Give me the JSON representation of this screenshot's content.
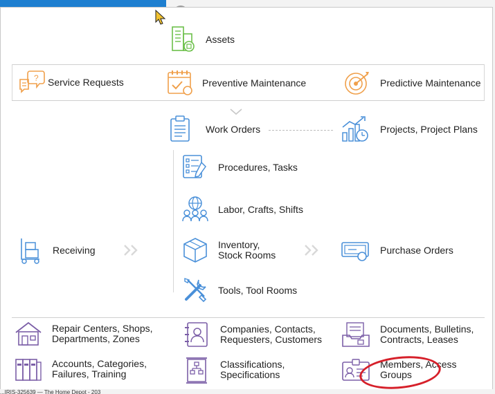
{
  "assets": {
    "label": "Assets"
  },
  "row1": {
    "service": "Service Requests",
    "preventive": "Preventive Maintenance",
    "predictive": "Predictive Maintenance"
  },
  "work": {
    "orders": "Work Orders",
    "projects": "Projects, Project Plans"
  },
  "sub": {
    "procedures": "Procedures, Tasks",
    "labor": "Labor, Crafts, Shifts",
    "inventory_1": "Inventory,",
    "inventory_2": "Stock Rooms",
    "tools": "Tools, Tool Rooms"
  },
  "receiving": "Receiving",
  "purchase": "Purchase Orders",
  "bottom": {
    "repair_1": "Repair Centers, Shops,",
    "repair_2": "Departments, Zones",
    "companies_1": "Companies, Contacts,",
    "companies_2": "Requesters, Customers",
    "documents_1": "Documents, Bulletins,",
    "documents_2": "Contracts, Leases",
    "accounts_1": "Accounts, Categories,",
    "accounts_2": "Failures, Training",
    "class_1": "Classifications,",
    "class_2": "Specifications",
    "members_1": "Members, Access",
    "members_2": "Groups"
  },
  "taskbar_text": "...IRIS-325639 — The Home Depot - 203",
  "colors": {
    "accent": "#1e7fd0",
    "orange": "#f0a04b",
    "green": "#6cc04a",
    "blue": "#4a90d9",
    "purple": "#7b5ea7",
    "annotation": "#d6202a"
  }
}
